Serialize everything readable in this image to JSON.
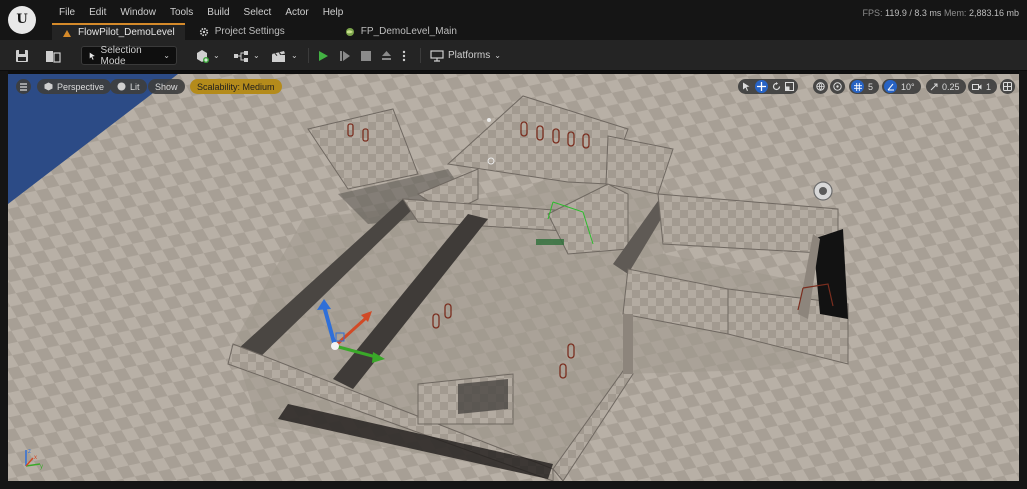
{
  "app": {
    "logo": "U"
  },
  "menu": [
    "File",
    "Edit",
    "Window",
    "Tools",
    "Build",
    "Select",
    "Actor",
    "Help"
  ],
  "tabs": [
    {
      "label": "FlowPilot_DemoLevel",
      "icon": "level-icon",
      "active": true
    },
    {
      "label": "Project Settings",
      "icon": "settings-icon",
      "active": false
    },
    {
      "label": "FP_DemoLevel_Main",
      "icon": "world-icon",
      "active": false
    }
  ],
  "stats": {
    "fps_label": "FPS:",
    "fps": "119.9",
    "ms": "/ 8.3 ms",
    "mem_label": "Mem:",
    "mem": "2,883.16 mb"
  },
  "toolbar": {
    "selection_mode": "Selection Mode",
    "platforms": "Platforms"
  },
  "viewport": {
    "perspective": "Perspective",
    "lit": "Lit",
    "show": "Show",
    "scalability": "Scalability: Medium",
    "grid_snap": "5",
    "rotation_snap": "10°",
    "scale_snap": "0.25",
    "camera_speed": "1"
  },
  "colors": {
    "accent": "#d58a2a",
    "active_blue": "#2763c4",
    "scalability": "#b48b1b",
    "sky": "#2c4b86"
  }
}
